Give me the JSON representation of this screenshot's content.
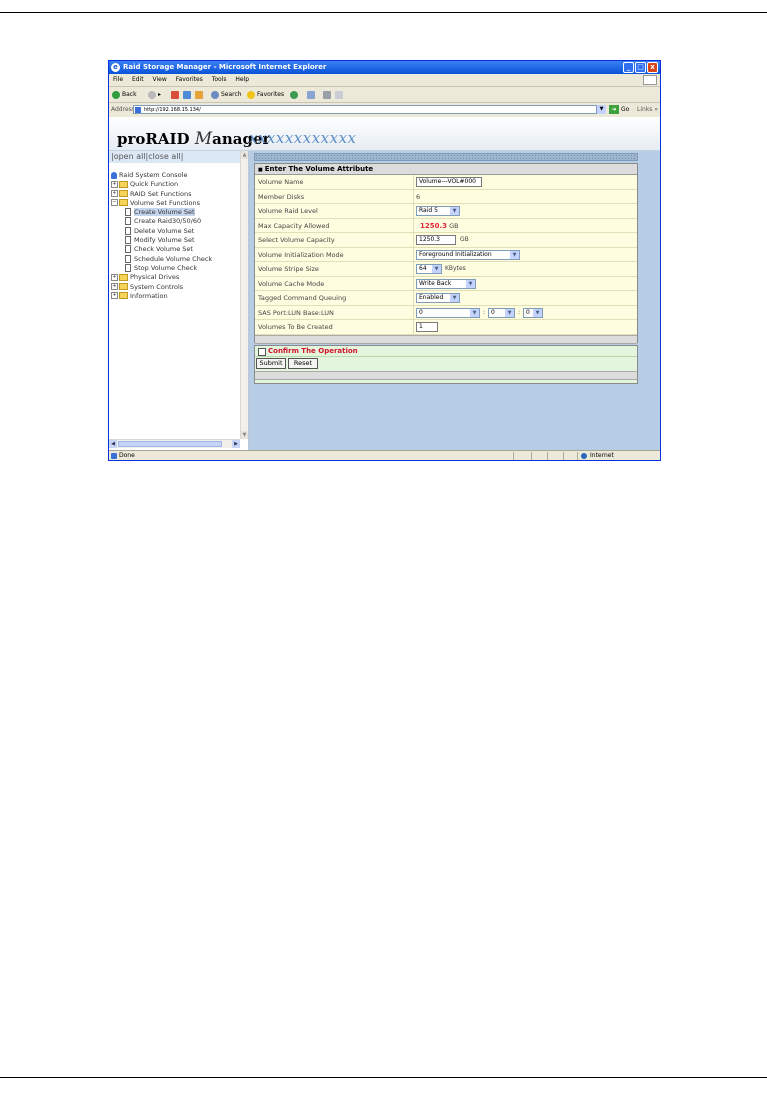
{
  "window": {
    "title": "Raid Storage Manager - Microsoft Internet Explorer",
    "ie_icon": "e",
    "controls": {
      "minimize": "_",
      "maximize": "□",
      "close": "x"
    }
  },
  "menu": [
    "File",
    "Edit",
    "View",
    "Favorites",
    "Tools",
    "Help"
  ],
  "toolbar": {
    "back": "Back",
    "forward_arrow": "▸",
    "search": "Search",
    "favorites": "Favorites"
  },
  "address": {
    "label": "Address",
    "url": "http://192.168.15.134/",
    "go": "Go",
    "links": "Links »"
  },
  "banner": {
    "logo_pro": "proRAID ",
    "logo_m": "M",
    "logo_rest": "anager",
    "model": "xxxxxxxxxxxx"
  },
  "left_panel": {
    "open_close": "|open all|close all|",
    "tree": [
      {
        "label": "Raid System Console",
        "type": "root"
      },
      {
        "label": "Quick Function",
        "type": "folder",
        "toggle": "+"
      },
      {
        "label": "RAID Set Functions",
        "type": "folder",
        "toggle": "+"
      },
      {
        "label": "Volume Set Functions",
        "type": "folder",
        "toggle": "−"
      },
      {
        "label": "Create Volume Set",
        "type": "page",
        "selected": true
      },
      {
        "label": "Create Raid30/50/60",
        "type": "page"
      },
      {
        "label": "Delete Volume Set",
        "type": "page"
      },
      {
        "label": "Modify Volume Set",
        "type": "page"
      },
      {
        "label": "Check Volume Set",
        "type": "page"
      },
      {
        "label": "Schedule Volume Check",
        "type": "page"
      },
      {
        "label": "Stop Volume Check",
        "type": "page"
      },
      {
        "label": "Physical Drives",
        "type": "folder",
        "toggle": "+"
      },
      {
        "label": "System Controls",
        "type": "folder",
        "toggle": "+"
      },
      {
        "label": "Information",
        "type": "folder",
        "toggle": "+"
      }
    ]
  },
  "form": {
    "header": "Enter The Volume Attribute",
    "header_bullet": "■",
    "volume_name": {
      "label": "Volume Name",
      "value": "Volume---VOL#000"
    },
    "member_disks": {
      "label": "Member Disks",
      "value": "6"
    },
    "raid_level": {
      "label": "Volume Raid Level",
      "value": "Raid 5"
    },
    "max_capacity": {
      "label": "Max Capacity Allowed",
      "value": "1250.3",
      "unit": "GB"
    },
    "select_capacity": {
      "label": "Select Volume Capacity",
      "value": "1250.3",
      "unit": "GB"
    },
    "init_mode": {
      "label": "Volume Initialization Mode",
      "value": "Foreground Initialization"
    },
    "stripe_size": {
      "label": "Volume Stripe Size",
      "value": "64",
      "unit": "KBytes"
    },
    "cache_mode": {
      "label": "Volume Cache Mode",
      "value": "Write Back"
    },
    "tcq": {
      "label": "Tagged Command Queuing",
      "value": "Enabled"
    },
    "sas_port": {
      "label": "SAS Port:LUN Base:LUN",
      "port": "0",
      "lun_base": "0",
      "lun": "0"
    },
    "volumes_count": {
      "label": "Volumes To Be Created",
      "value": "1"
    },
    "confirm_label": "Confirm The Operation",
    "submit": "Submit",
    "reset": "Reset"
  },
  "status": {
    "text": "Done",
    "zone": "Internet"
  },
  "colors": {
    "accent_red": "#e0283b",
    "form_row_bg": "#fffde0",
    "confirm_bg": "#e3f6dd",
    "frame_bg": "#b7cde6"
  }
}
